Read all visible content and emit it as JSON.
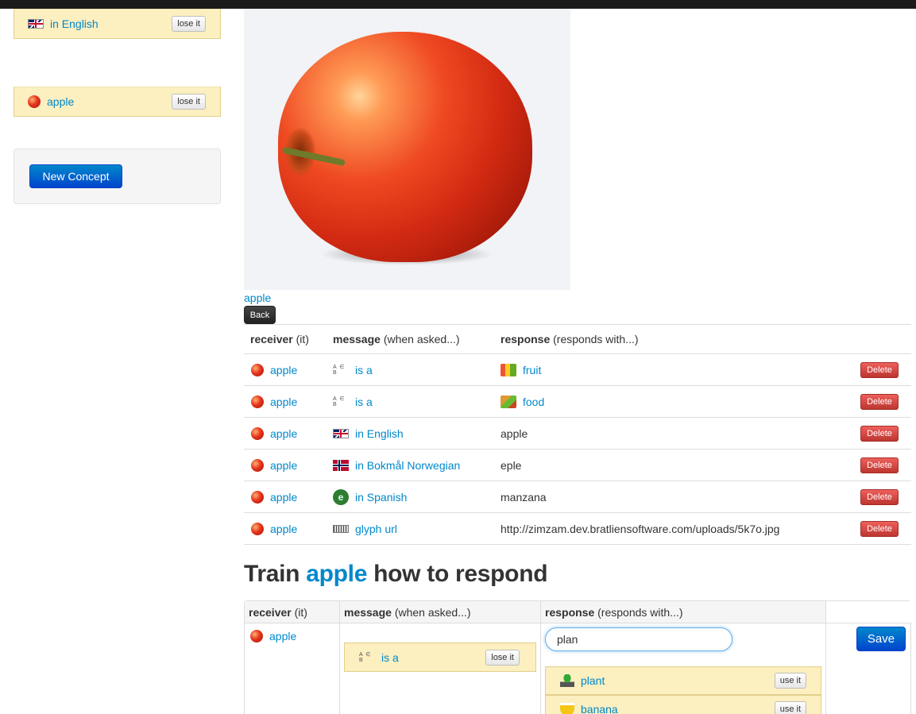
{
  "sidebar": {
    "slot1": {
      "icon": "uk-flag-icon",
      "label": "in English",
      "button": "lose it"
    },
    "slot2": {
      "icon": "apple-icon",
      "label": "apple",
      "button": "lose it"
    },
    "new_concept": "New Concept"
  },
  "concept": {
    "image_alt": "apple",
    "caption": "apple",
    "back": "Back"
  },
  "relations": {
    "headers": [
      {
        "bold": "receiver",
        "rest": " (it)"
      },
      {
        "bold": "message",
        "rest": " (when asked...)"
      },
      {
        "bold": "response",
        "rest": " (responds with...)"
      }
    ],
    "delete_label": "Delete",
    "rows": [
      {
        "receiver": "apple",
        "message_icon": "is-a-icon",
        "message": "is a",
        "response_icon": "fruit-icon",
        "response": "fruit",
        "response_link": true
      },
      {
        "receiver": "apple",
        "message_icon": "is-a-icon",
        "message": "is a",
        "response_icon": "food-icon",
        "response": "food",
        "response_link": true
      },
      {
        "receiver": "apple",
        "message_icon": "uk-flag-icon",
        "message": "in English",
        "response": "apple",
        "response_link": false
      },
      {
        "receiver": "apple",
        "message_icon": "norway-flag-icon",
        "message": "in Bokmål Norwegian",
        "response": "eple",
        "response_link": false
      },
      {
        "receiver": "apple",
        "message_icon": "spanish-icon",
        "message": "in Spanish",
        "response": "manzana",
        "response_link": false
      },
      {
        "receiver": "apple",
        "message_icon": "glyph-icon",
        "message": "glyph url",
        "response": "http://zimzam.dev.bratliensoftware.com/uploads/5k7o.jpg",
        "response_link": false
      }
    ]
  },
  "train": {
    "heading_pre": "Train ",
    "heading_concept": "apple",
    "heading_post": " how to respond",
    "headers": [
      {
        "bold": "receiver",
        "rest": " (it)"
      },
      {
        "bold": "message",
        "rest": " (when asked...)"
      },
      {
        "bold": "response",
        "rest": " (responds with...)"
      }
    ],
    "receiver": "apple",
    "message": "is a",
    "message_button": "lose it",
    "search_value": "plan",
    "suggestions": [
      {
        "icon": "plant-icon",
        "label": "plant",
        "button": "use it"
      },
      {
        "icon": "banana-icon",
        "label": "banana",
        "button": "use it"
      }
    ],
    "save": "Save"
  },
  "colors": {
    "link": "#0088cc",
    "slot_bg": "#fcefc0",
    "primary": "#0066cc",
    "danger": "#da4f49",
    "topbar": "#1b1b1b"
  }
}
